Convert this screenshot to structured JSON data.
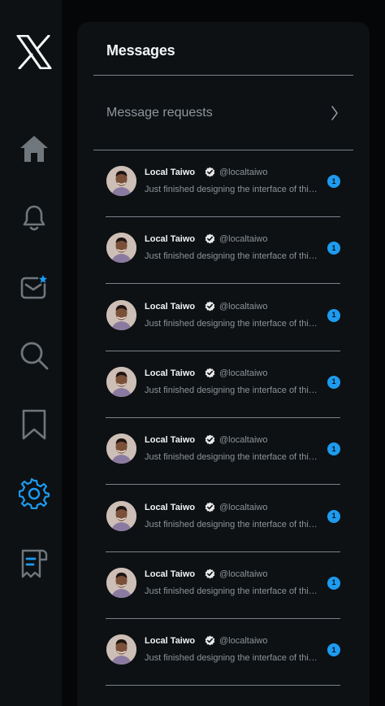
{
  "sidebar": {
    "icons": [
      "x-logo-icon",
      "home-icon",
      "bell-icon",
      "mail-icon",
      "search-icon",
      "bookmark-icon",
      "gear-icon",
      "lists-icon"
    ],
    "accent": "#1d9bf0"
  },
  "panel": {
    "title": "Messages",
    "requests_label": "Message requests"
  },
  "messages": [
    {
      "name": "Local Taiwo",
      "handle": "@localtaiwo",
      "preview": "Just finished designing the interface of this app",
      "unread": "1"
    },
    {
      "name": "Local Taiwo",
      "handle": "@localtaiwo",
      "preview": "Just finished designing the interface of this app",
      "unread": "1"
    },
    {
      "name": "Local Taiwo",
      "handle": "@localtaiwo",
      "preview": "Just finished designing the interface of this app",
      "unread": "1"
    },
    {
      "name": "Local Taiwo",
      "handle": "@localtaiwo",
      "preview": "Just finished designing the interface of this app",
      "unread": "1"
    },
    {
      "name": "Local Taiwo",
      "handle": "@localtaiwo",
      "preview": "Just finished designing the interface of this app",
      "unread": "1"
    },
    {
      "name": "Local Taiwo",
      "handle": "@localtaiwo",
      "preview": "Just finished designing the interface of this app",
      "unread": "1"
    },
    {
      "name": "Local Taiwo",
      "handle": "@localtaiwo",
      "preview": "Just finished designing the interface of this app",
      "unread": "1"
    },
    {
      "name": "Local Taiwo",
      "handle": "@localtaiwo",
      "preview": "Just finished designing the interface of this app",
      "unread": "1"
    }
  ]
}
